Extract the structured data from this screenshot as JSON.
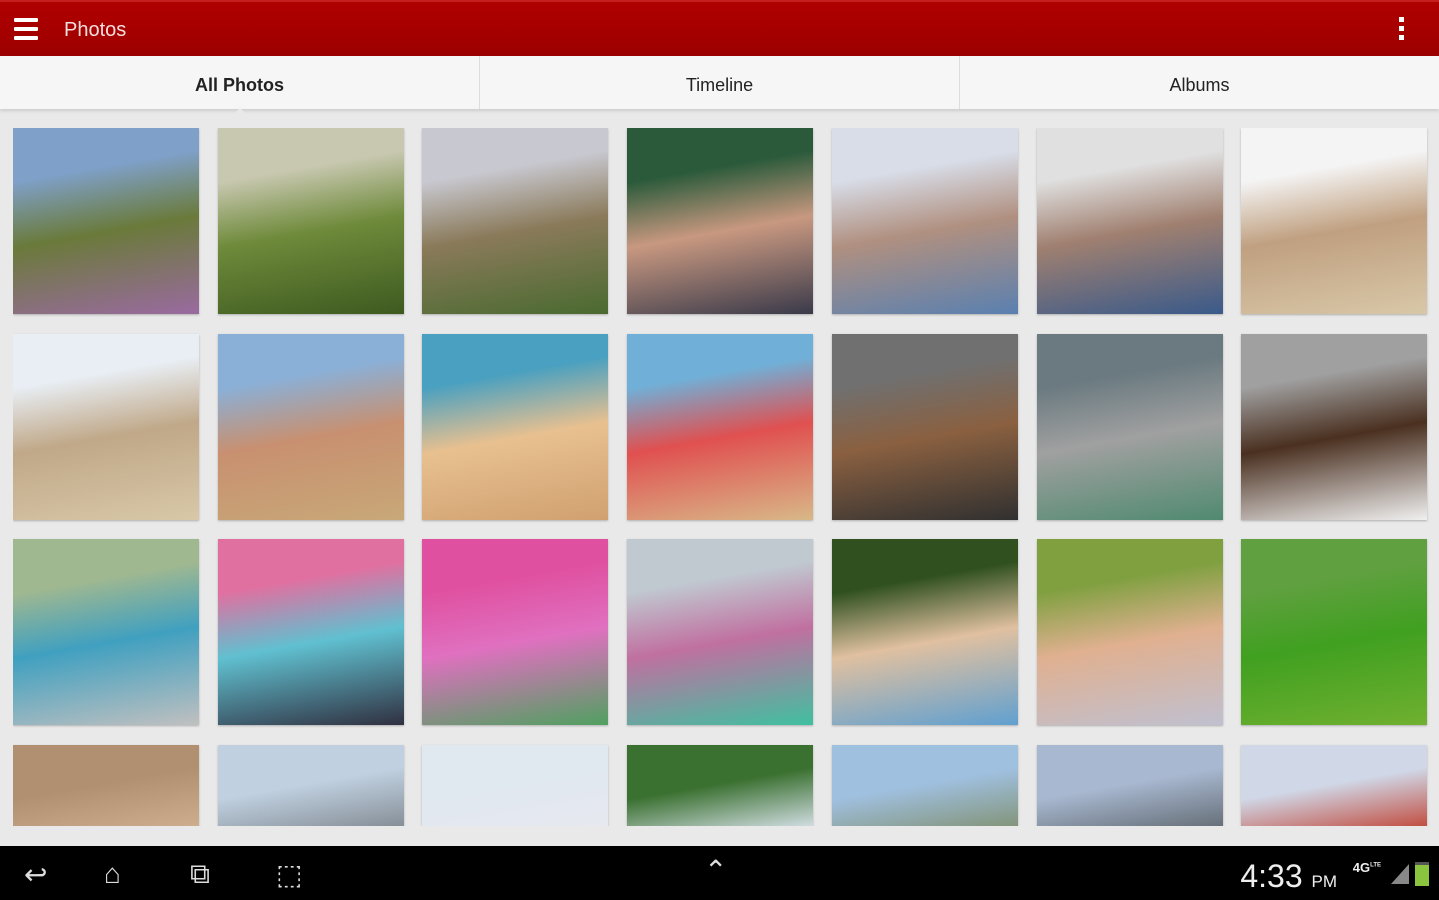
{
  "appbar": {
    "title": "Photos",
    "menu_icon": "hamburger-icon",
    "overflow_icon": "more-vert-icon",
    "color": "#a80000"
  },
  "tabs": [
    {
      "label": "All Photos",
      "active": true
    },
    {
      "label": "Timeline"
    },
    {
      "label": "Albums"
    }
  ],
  "photos": [
    [
      "#7fa0c8",
      "#6a7a3a",
      "#9a6aa0"
    ],
    [
      "#c8c8b0",
      "#6e8a3a",
      "#3e5a20"
    ],
    [
      "#c8c8d0",
      "#8a7a5a",
      "#4a6a30"
    ],
    [
      "#2a5a3a",
      "#c89880",
      "#3a3a4a"
    ],
    [
      "#d8dde8",
      "#b09080",
      "#5a80b0"
    ],
    [
      "#e0e0e0",
      "#a08070",
      "#3a5a8a"
    ],
    [
      "#f4f4f4",
      "#c0a080",
      "#d8c8a8"
    ],
    [
      "#e8eef4",
      "#c0a888",
      "#d8c8a8"
    ],
    [
      "#8ab0d8",
      "#c89070",
      "#c8a878"
    ],
    [
      "#4aa0c0",
      "#e8c090",
      "#d0a070"
    ],
    [
      "#70b0d8",
      "#e05050",
      "#d8b888"
    ],
    [
      "#707070",
      "#8a6040",
      "#303030"
    ],
    [
      "#6a7a80",
      "#a0a0a0",
      "#508a70"
    ],
    [
      "#a0a0a0",
      "#4a3020",
      "#f0f0f0"
    ],
    [
      "#a0b890",
      "#40a0c0",
      "#c0c0c0"
    ],
    [
      "#e070a0",
      "#60c0d0",
      "#303040"
    ],
    [
      "#e050a0",
      "#e070c0",
      "#50a060"
    ],
    [
      "#c0c8d0",
      "#c070a0",
      "#40c0a0"
    ],
    [
      "#305020",
      "#e0c0a0",
      "#60a0d0"
    ],
    [
      "#80a040",
      "#e0b090",
      "#c0c0d0"
    ],
    [
      "#60a040",
      "#40a020",
      "#70b030"
    ],
    [
      "#b09070",
      "#d0b090",
      "#807060"
    ],
    [
      "#c0d0e0",
      "#808890",
      "#604030"
    ],
    [
      "#e0e8f0",
      "#e8e8f0",
      "#a09080"
    ],
    [
      "#3a7030",
      "#e0e8f4",
      "#a0b0c0"
    ],
    [
      "#a0c0e0",
      "#809070",
      "#e8d8c0"
    ],
    [
      "#a8b8d0",
      "#606870",
      "#a0a8b0"
    ],
    [
      "#d0d8e8",
      "#c04030",
      "#8090a0"
    ]
  ],
  "navbar": {
    "back_icon": "back-icon",
    "home_icon": "home-icon",
    "recents_icon": "recent-apps-icon",
    "screenshot_icon": "screenshot-icon",
    "up_icon": "chevron-up-icon",
    "time": "4:33",
    "ampm": "PM",
    "network": "4G",
    "network_sub": "LTE"
  }
}
